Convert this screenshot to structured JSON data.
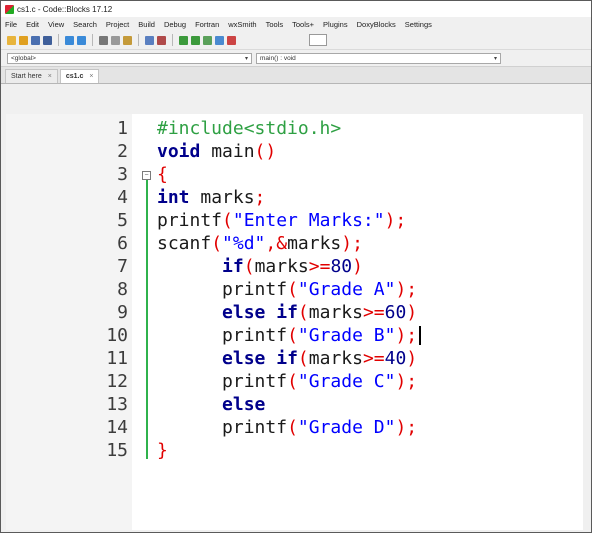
{
  "window": {
    "title": "cs1.c - Code::Blocks 17.12"
  },
  "menubar": {
    "items": [
      "File",
      "Edit",
      "View",
      "Search",
      "Project",
      "Build",
      "Debug",
      "Fortran",
      "wxSmith",
      "Tools",
      "Tools+",
      "Plugins",
      "DoxyBlocks",
      "Settings"
    ]
  },
  "scope": {
    "left": "<global>",
    "right": "main() : void"
  },
  "tabs": [
    {
      "label": "Start here",
      "active": false
    },
    {
      "label": "cs1.c",
      "active": true
    }
  ],
  "colors": {
    "keyword": "#00008b",
    "preprocessor": "#2ea043",
    "string": "#0000ff",
    "operator": "#e10000",
    "fold_line": "#2fb24c"
  },
  "editor": {
    "lines": [
      {
        "number": "1",
        "indent": 0,
        "tokens": [
          {
            "t": "#include<stdio.h>",
            "k": "pre"
          }
        ]
      },
      {
        "number": "2",
        "indent": 0,
        "tokens": [
          {
            "t": "void",
            "k": "kw"
          },
          {
            "t": " main",
            "k": "id"
          },
          {
            "t": "()",
            "k": "op"
          }
        ]
      },
      {
        "number": "3",
        "indent": 0,
        "tokens": [
          {
            "t": "{",
            "k": "op"
          }
        ]
      },
      {
        "number": "4",
        "indent": 0,
        "tokens": [
          {
            "t": "int",
            "k": "kw"
          },
          {
            "t": " marks",
            "k": "id"
          },
          {
            "t": ";",
            "k": "op"
          }
        ]
      },
      {
        "number": "5",
        "indent": 0,
        "tokens": [
          {
            "t": "printf",
            "k": "id"
          },
          {
            "t": "(",
            "k": "op"
          },
          {
            "t": "\"Enter Marks:\"",
            "k": "str"
          },
          {
            "t": ");",
            "k": "op"
          }
        ]
      },
      {
        "number": "6",
        "indent": 0,
        "tokens": [
          {
            "t": "scanf",
            "k": "id"
          },
          {
            "t": "(",
            "k": "op"
          },
          {
            "t": "\"%d\"",
            "k": "str"
          },
          {
            "t": ",&",
            "k": "op"
          },
          {
            "t": "marks",
            "k": "id"
          },
          {
            "t": ");",
            "k": "op"
          }
        ]
      },
      {
        "number": "7",
        "indent": 6,
        "tokens": [
          {
            "t": "if",
            "k": "kw"
          },
          {
            "t": "(",
            "k": "op"
          },
          {
            "t": "marks",
            "k": "id"
          },
          {
            "t": ">=",
            "k": "op"
          },
          {
            "t": "80",
            "k": "num"
          },
          {
            "t": ")",
            "k": "op"
          }
        ]
      },
      {
        "number": "8",
        "indent": 6,
        "tokens": [
          {
            "t": "printf",
            "k": "id"
          },
          {
            "t": "(",
            "k": "op"
          },
          {
            "t": "\"Grade A\"",
            "k": "str"
          },
          {
            "t": ");",
            "k": "op"
          }
        ]
      },
      {
        "number": "9",
        "indent": 6,
        "tokens": [
          {
            "t": "else",
            "k": "kw"
          },
          {
            "t": " ",
            "k": "id"
          },
          {
            "t": "if",
            "k": "kw"
          },
          {
            "t": "(",
            "k": "op"
          },
          {
            "t": "marks",
            "k": "id"
          },
          {
            "t": ">=",
            "k": "op"
          },
          {
            "t": "60",
            "k": "num"
          },
          {
            "t": ")",
            "k": "op"
          }
        ]
      },
      {
        "number": "10",
        "indent": 6,
        "tokens": [
          {
            "t": "printf",
            "k": "id"
          },
          {
            "t": "(",
            "k": "op"
          },
          {
            "t": "\"Grade B\"",
            "k": "str"
          },
          {
            "t": ");",
            "k": "op"
          }
        ],
        "caret": true
      },
      {
        "number": "11",
        "indent": 6,
        "tokens": [
          {
            "t": "else",
            "k": "kw"
          },
          {
            "t": " ",
            "k": "id"
          },
          {
            "t": "if",
            "k": "kw"
          },
          {
            "t": "(",
            "k": "op"
          },
          {
            "t": "marks",
            "k": "id"
          },
          {
            "t": ">=",
            "k": "op"
          },
          {
            "t": "40",
            "k": "num"
          },
          {
            "t": ")",
            "k": "op"
          }
        ]
      },
      {
        "number": "12",
        "indent": 6,
        "tokens": [
          {
            "t": "printf",
            "k": "id"
          },
          {
            "t": "(",
            "k": "op"
          },
          {
            "t": "\"Grade C\"",
            "k": "str"
          },
          {
            "t": ");",
            "k": "op"
          }
        ]
      },
      {
        "number": "13",
        "indent": 6,
        "tokens": [
          {
            "t": "else",
            "k": "kw"
          }
        ]
      },
      {
        "number": "14",
        "indent": 6,
        "tokens": [
          {
            "t": "printf",
            "k": "id"
          },
          {
            "t": "(",
            "k": "op"
          },
          {
            "t": "\"Grade D\"",
            "k": "str"
          },
          {
            "t": ");",
            "k": "op"
          }
        ]
      },
      {
        "number": "15",
        "indent": 0,
        "tokens": [
          {
            "t": "}",
            "k": "op"
          }
        ]
      }
    ]
  }
}
